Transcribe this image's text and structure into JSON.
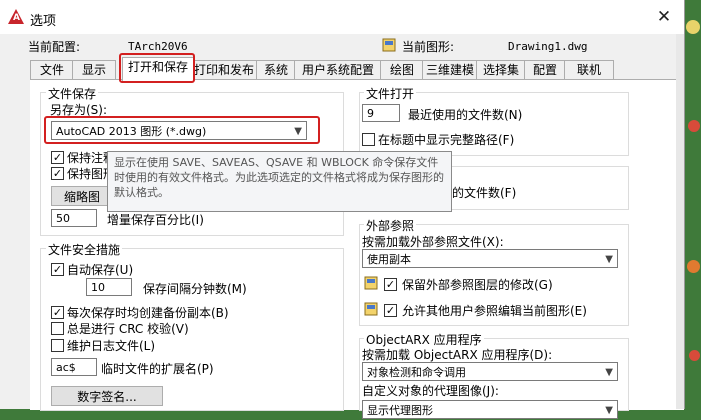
{
  "window": {
    "title": "选项",
    "close_glyph": "✕"
  },
  "header": {
    "current_profile_label": "当前配置:",
    "current_profile_value": "TArch20V6",
    "current_drawing_label": "当前图形:",
    "current_drawing_value": "Drawing1.dwg"
  },
  "tabs": [
    "文件",
    "显示",
    "打开和保存",
    "打印和发布",
    "系统",
    "用户系统配置",
    "绘图",
    "三维建模",
    "选择集",
    "配置",
    "联机"
  ],
  "file_save": {
    "legend": "文件保存",
    "save_as_label": "另存为(S):",
    "save_as_value": "AutoCAD 2013 图形 (*.dwg)",
    "keep_annot": "保持注释",
    "keep_drawing": "保持图形",
    "thumbnail_button": "缩略图",
    "incremental_value": "50",
    "incremental_label": "增量保存百分比(I)"
  },
  "tooltip": {
    "text": "显示在使用 SAVE、SAVEAS、QSAVE 和 WBLOCK 命令保存文件时使用的有效文件格式。为此选项选定的文件格式将成为保存图形的默认格式。"
  },
  "file_safety": {
    "legend": "文件安全措施",
    "autosave": "自动保存(U)",
    "interval_value": "10",
    "interval_label": "保存间隔分钟数(M)",
    "backup": "每次保存时均创建备份副本(B)",
    "crc": "总是进行 CRC 校验(V)",
    "log": "维护日志文件(L)",
    "temp_ext_value": "ac$",
    "temp_ext_label": "临时文件的扩展名(P)",
    "digital_sign_button": "数字签名..."
  },
  "file_open": {
    "legend": "文件打开",
    "recent_value": "9",
    "recent_label": "最近使用的文件数(N)",
    "full_path": "在标题中显示完整路径(F)",
    "app_menu_recent_label": "的文件数(F)"
  },
  "xref": {
    "legend": "外部参照",
    "demand_load_label": "按需加载外部参照文件(X):",
    "demand_load_value": "使用副本",
    "retain_changes": "保留外部参照图层的修改(G)",
    "allow_edit": "允许其他用户参照编辑当前图形(E)"
  },
  "objectarx": {
    "legend": "ObjectARX 应用程序",
    "demand_load_label": "按需加载 ObjectARX 应用程序(D):",
    "demand_load_value": "对象检测和命令调用",
    "proxy_label": "自定义对象的代理图像(J):",
    "proxy_value": "显示代理图形"
  },
  "colors": {
    "highlight": "#d32020",
    "title_icon": "#c8252c"
  }
}
